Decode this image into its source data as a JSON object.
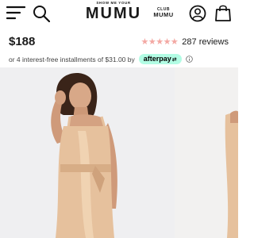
{
  "header": {
    "tagline": "SHOW ME YOUR",
    "logo": "MUMU",
    "club_top": "CLUB",
    "club_bottom": "MUMU",
    "icons": [
      "menu-icon",
      "search-icon",
      "account-icon",
      "shopping-bag-icon"
    ]
  },
  "product": {
    "price": "$188",
    "rating": {
      "stars": "★★★★★",
      "reviews": "287 reviews",
      "star_color": "#f3a8a3"
    },
    "installments": {
      "text": "or 4 interest-free installments of $31.00 by",
      "provider": "afterpay",
      "provider_icon": "⇄",
      "provider_color": "#b2fce4"
    }
  },
  "gallery": {
    "images": [
      "model-in-champagne-satin-dress",
      "next-product-photo"
    ]
  }
}
